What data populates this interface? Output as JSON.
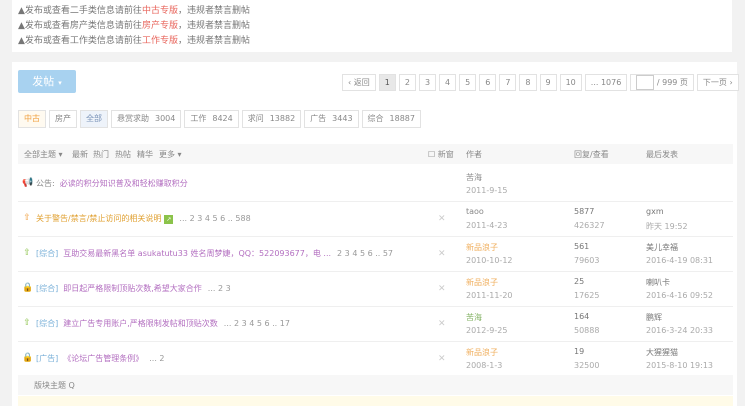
{
  "notices": [
    {
      "prefix": "▲发布或查看二手类信息请前往",
      "link": "中古专版",
      "suffix": "，违规者禁言删帖"
    },
    {
      "prefix": "▲发布或查看房产类信息请前往",
      "link": "房产专版",
      "suffix": "，违规者禁言删帖"
    },
    {
      "prefix": "▲发布或查看工作类信息请前往",
      "link": "工作专版",
      "suffix": "，违规者禁言删帖"
    }
  ],
  "post_button": {
    "label": "发帖",
    "caret": "▾"
  },
  "pagination": {
    "prev": "‹ 返回",
    "pages": [
      "1",
      "2",
      "3",
      "4",
      "5",
      "6",
      "7",
      "8",
      "9",
      "10",
      "... 1076"
    ],
    "current": "1",
    "total": "/ 999 页",
    "next": "下一页 ›"
  },
  "tabs": [
    {
      "label": "中古",
      "count": ""
    },
    {
      "label": "房产",
      "count": ""
    },
    {
      "label": "全部",
      "count": ""
    },
    {
      "label": "悬赏求助",
      "count": "3004"
    },
    {
      "label": "工作",
      "count": "8424"
    },
    {
      "label": "求问",
      "count": "13882"
    },
    {
      "label": "广告",
      "count": "3443"
    },
    {
      "label": "综合",
      "count": "18887"
    }
  ],
  "table_header": {
    "all_topics": "全部主题 ▾",
    "latest": "最新",
    "hot": "热门",
    "hot_post": "热帖",
    "digest": "精华",
    "more": "更多 ▾",
    "new_window": "新窗",
    "author": "作者",
    "reply_view": "回复/查看",
    "last_post": "最后发表"
  },
  "rows": [
    {
      "icon": "announcement-icon",
      "glyph": "📢",
      "cat": "公告:",
      "title": "必读的积分知识普及和轻松赚取积分",
      "pages": "",
      "author": "苦海",
      "date": "2011-9-15",
      "replies": "",
      "views": "",
      "last": "",
      "lastdate": "",
      "author_color": "",
      "new": "",
      "x": ""
    },
    {
      "icon": "pin-icon",
      "glyph": "⇧",
      "cat": "",
      "title": "关于警告/禁言/禁止访问的相关说明",
      "pages": "... 2 3 4 5 6 .. 588",
      "author": "taoo",
      "date": "2011-4-23",
      "replies": "5877",
      "views": "426327",
      "last": "gxm",
      "lastdate": "昨天 19:52",
      "author_color": "",
      "new": "↗",
      "x": "✕"
    },
    {
      "icon": "pin-icon",
      "glyph": "⇧",
      "cat": "[综合]",
      "title": "互助交易最新黑名单 asukatutu33 姓名周梦婕，QQ：522093677，电 ...",
      "pages": "2 3 4 5 6 .. 57",
      "author": "新品浪子",
      "date": "2010-10-12",
      "replies": "561",
      "views": "79603",
      "last": "美儿幸福",
      "lastdate": "2016-4-19 08:31",
      "author_color": "orange",
      "new": "",
      "x": "✕"
    },
    {
      "icon": "lock-icon",
      "glyph": "🔒",
      "cat": "[综合]",
      "title": "即日起严格限制顶贴次数,希望大家合作",
      "pages": "... 2 3",
      "author": "新品浪子",
      "date": "2011-11-20",
      "replies": "25",
      "views": "17625",
      "last": "喇叭卡",
      "lastdate": "2016-4-16 09:52",
      "author_color": "orange",
      "new": "",
      "x": "✕"
    },
    {
      "icon": "pin-icon",
      "glyph": "⇧",
      "cat": "[综合]",
      "title": "建立广告专用账户,严格限制发帖和顶贴次数",
      "pages": "... 2 3 4 5 6 .. 17",
      "author": "苦海",
      "date": "2012-9-25",
      "replies": "164",
      "views": "50888",
      "last": "鹏辉",
      "lastdate": "2016-3-24 20:33",
      "author_color": "green",
      "new": "",
      "x": "✕"
    },
    {
      "icon": "lock-icon",
      "glyph": "🔒",
      "cat": "[广告]",
      "title": "《论坛广告管理条例》",
      "pages": "... 2",
      "author": "新品浪子",
      "date": "2008-1-3",
      "replies": "19",
      "views": "32500",
      "last": "大猩猩猫",
      "lastdate": "2015-8-10 19:13",
      "author_color": "orange",
      "new": "",
      "x": "✕"
    }
  ],
  "block_bar": "版块主题 Q",
  "colors": {
    "accent": "#a8d2f0",
    "link_red": "#e8665d",
    "title_purple": "#b36fc0",
    "cat_blue": "#7ab0d8"
  }
}
